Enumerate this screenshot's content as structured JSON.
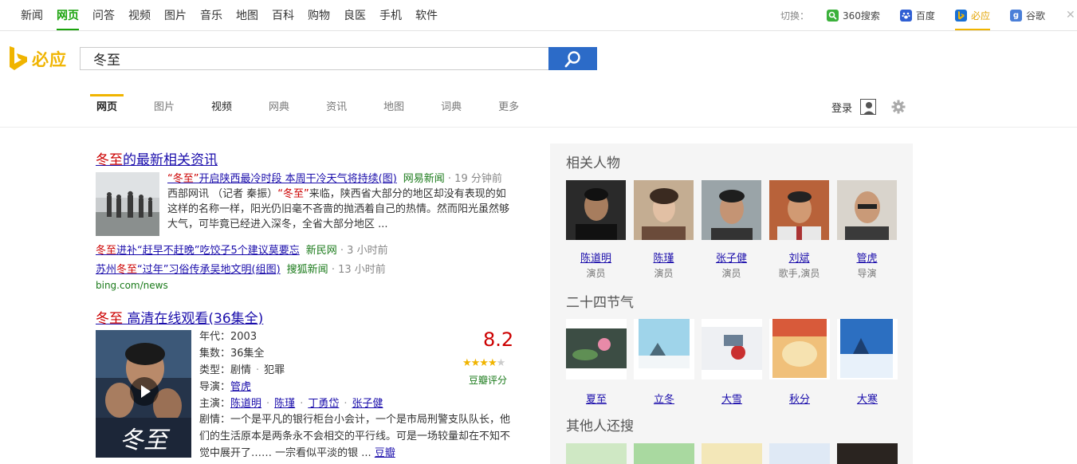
{
  "topnav": [
    "新闻",
    "网页",
    "问答",
    "视频",
    "图片",
    "音乐",
    "地图",
    "百科",
    "购物",
    "良医",
    "手机",
    "软件"
  ],
  "switcher": {
    "label": "切换：",
    "engines": [
      {
        "name": "360搜索",
        "color": "#3bb13b"
      },
      {
        "name": "百度",
        "color": "#2f5fd3"
      },
      {
        "name": "必应",
        "color": "#1a6fd3"
      },
      {
        "name": "谷歌",
        "color": "#4a7fd8"
      }
    ]
  },
  "logo_text": "必应",
  "search": {
    "query": "冬至"
  },
  "tabs": [
    "网页",
    "图片",
    "视频",
    "网典",
    "资讯",
    "地图",
    "词典",
    "更多"
  ],
  "login_label": "登录",
  "news": {
    "title_hl": "冬至",
    "title_rest": "的最新相关资讯",
    "main_link_q1": "“冬至”",
    "main_link_rest": "开启陕西最冷时段 本周干冷天气将持续(图)",
    "main_source": "网易新闻",
    "main_time": "· 19 分钟前",
    "snippet_pre": "西部网讯 （记者 秦振）",
    "snippet_hl": "“冬至”",
    "snippet_rest": "来临，陕西省大部分的地区却没有表现的如这样的名称一样，阳光仍旧毫不吝啬的抛洒着自己的热情。然而阳光虽然够大气，可毕竟已经进入深冬，全省大部分地区 ...",
    "line2_hl": "冬至",
    "line2_rest": "进补“赶早不赶晚”吃饺子5个建议莫要忘",
    "line2_source": "新民网",
    "line2_time": "· 3 小时前",
    "line3_pre": "苏州",
    "line3_hl": "冬至",
    "line3_rest": "“过年”习俗传承吴地文明(组图)",
    "line3_source": "搜狐新闻",
    "line3_time": "· 13 小时前",
    "url": "bing.com/news"
  },
  "video": {
    "title_hl": "冬至",
    "title_rest": " 高清在线观看(36集全)",
    "year_label": "年代：",
    "year": "2003",
    "episodes_label": "集数：",
    "episodes": "36集全",
    "genre_label": "类型：",
    "genre1": "剧情",
    "genre2": "犯罪",
    "director_label": "导演：",
    "director": "管虎",
    "cast_label": "主演：",
    "cast": [
      "陈道明",
      "陈瑾",
      "丁勇岱",
      "张子健"
    ],
    "plot_label": "剧情：",
    "plot": "一个是平凡的银行柜台小会计，一个是市局刑警支队队长，他们的生活原本是两条永不会相交的平行线。可是一场较量却在不知不觉中展开了…… 一宗看似平淡的银 ...",
    "plot_link": "豆瓣",
    "score": "8.2",
    "stars": 4,
    "score_label": "豆瓣评分"
  },
  "related_people": {
    "heading": "相关人物",
    "people": [
      {
        "name": "陈道明",
        "role": "演员"
      },
      {
        "name": "陈瑾",
        "role": "演员"
      },
      {
        "name": "张子健",
        "role": "演员"
      },
      {
        "name": "刘斌",
        "role": "歌手,演员"
      },
      {
        "name": "管虎",
        "role": "导演"
      }
    ]
  },
  "solar_terms": {
    "heading": "二十四节气",
    "terms": [
      "夏至",
      "立冬",
      "大雪",
      "秋分",
      "大寒"
    ]
  },
  "others": {
    "heading": "其他人还搜"
  }
}
